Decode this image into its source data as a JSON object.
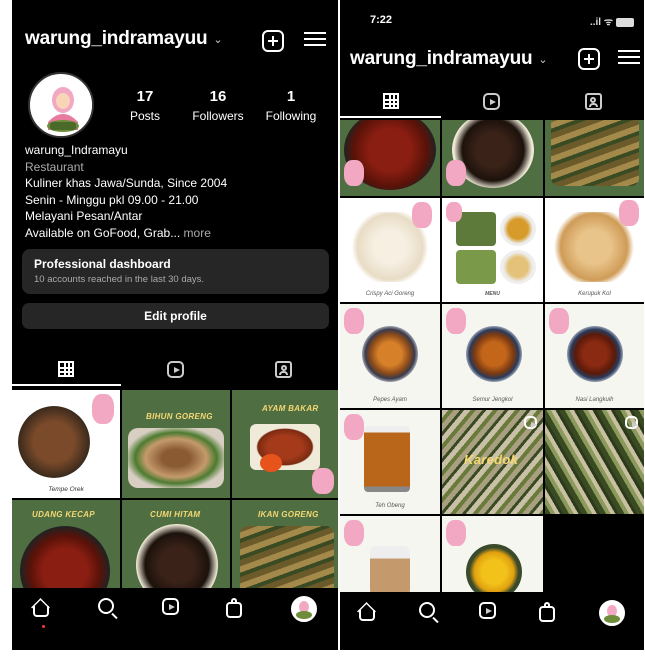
{
  "screen1": {
    "username": "warung_indramayuu",
    "stats": [
      {
        "value": "17",
        "label": "Posts"
      },
      {
        "value": "16",
        "label": "Followers"
      },
      {
        "value": "1",
        "label": "Following"
      }
    ],
    "bio": {
      "name": "warung_Indramayu",
      "category": "Restaurant",
      "lines": [
        "Kuliner khas Jawa/Sunda, Since 2004",
        "Senin - Minggu pkl 09.00 - 21.00",
        "Melayani Pesan/Antar"
      ],
      "last_line": "Available on GoFood, Grab...",
      "more": "more"
    },
    "dashboard": {
      "title": "Professional dashboard",
      "subtitle": "10 accounts reached in the last 30 days."
    },
    "edit_profile": "Edit profile",
    "captions": [
      "Tempe Orek",
      "BIHUN GORENG",
      "AYAM BAKAR",
      "UDANG KECAP",
      "CUMI HITAM",
      "IKAN GORENG"
    ]
  },
  "screen2": {
    "time": "7:22",
    "status_icons": "..il ᯤ",
    "battery": "90",
    "username": "warung_indramayuu",
    "captions": [
      "Crispy Aci Goreng",
      "MENU",
      "Kerupuk Kol",
      "Pepes Ayam",
      "Semur Jengkol",
      "Nasi Langkuih",
      "Teh Obeng",
      "Karedok"
    ]
  },
  "colors": {
    "card_green": "#4f6f43",
    "dark_bg": "#000000",
    "button_bg": "#262626"
  },
  "icons": [
    "new-post-icon",
    "menu-icon",
    "grid-icon",
    "reels-icon",
    "tagged-icon",
    "home-icon",
    "search-icon",
    "shop-icon"
  ]
}
